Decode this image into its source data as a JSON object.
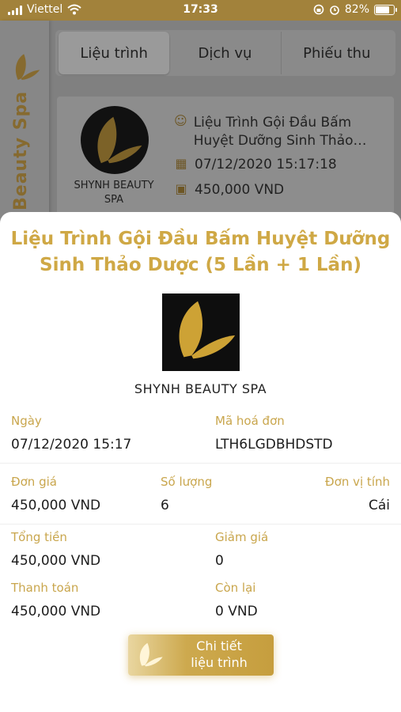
{
  "status_bar": {
    "carrier": "Viettel",
    "time": "17:33",
    "battery_percent": "82%",
    "battery_level": 0.82
  },
  "side_rail": {
    "brand_text": "Beauty Spa"
  },
  "tabs": [
    {
      "label": "Liệu trình",
      "active": true
    },
    {
      "label": "Dịch vụ",
      "active": false
    },
    {
      "label": "Phiếu thu",
      "active": false
    }
  ],
  "card": {
    "brand": "SHYNH BEAUTY SPA",
    "title": "Liệu Trình Gội Đầu Bấm Huyệt Dưỡng Sinh Thảo…",
    "datetime": "07/12/2020 15:17:18",
    "price": "450,000 VND"
  },
  "sheet": {
    "title": "Liệu Trình Gội Đầu Bấm Huyệt Dưỡng Sinh Thảo Dược (5 Lần + 1 Lần)",
    "brand": "SHYNH BEAUTY SPA",
    "date_label": "Ngày",
    "date_value": "07/12/2020 15:17",
    "invoice_label": "Mã hoá đơn",
    "invoice_value": "LTH6LGDBHDSTD",
    "unit_price_label": "Đơn giá",
    "unit_price_value": "450,000 VND",
    "quantity_label": "Số lượng",
    "quantity_value": "6",
    "unit_label": "Đơn vị tính",
    "unit_value": "Cái",
    "total_label": "Tổng tiền",
    "total_value": "450,000 VND",
    "discount_label": "Giảm giá",
    "discount_value": "0",
    "paid_label": "Thanh toán",
    "paid_value": "450,000 VND",
    "remaining_label": "Còn lại",
    "remaining_value": "0 VND",
    "detail_button": {
      "line1": "Chi tiết",
      "line2": "liệu trình"
    }
  },
  "colors": {
    "brand_gold": "#cfa845",
    "label_gold": "#c9a64d",
    "status_bar": "#a2823b"
  },
  "icons": [
    "signal-icon",
    "wifi-icon",
    "lock-rotation-icon",
    "alarm-icon",
    "battery-icon",
    "butterfly-logo-icon",
    "customer-icon",
    "calendar-icon",
    "cash-icon"
  ]
}
